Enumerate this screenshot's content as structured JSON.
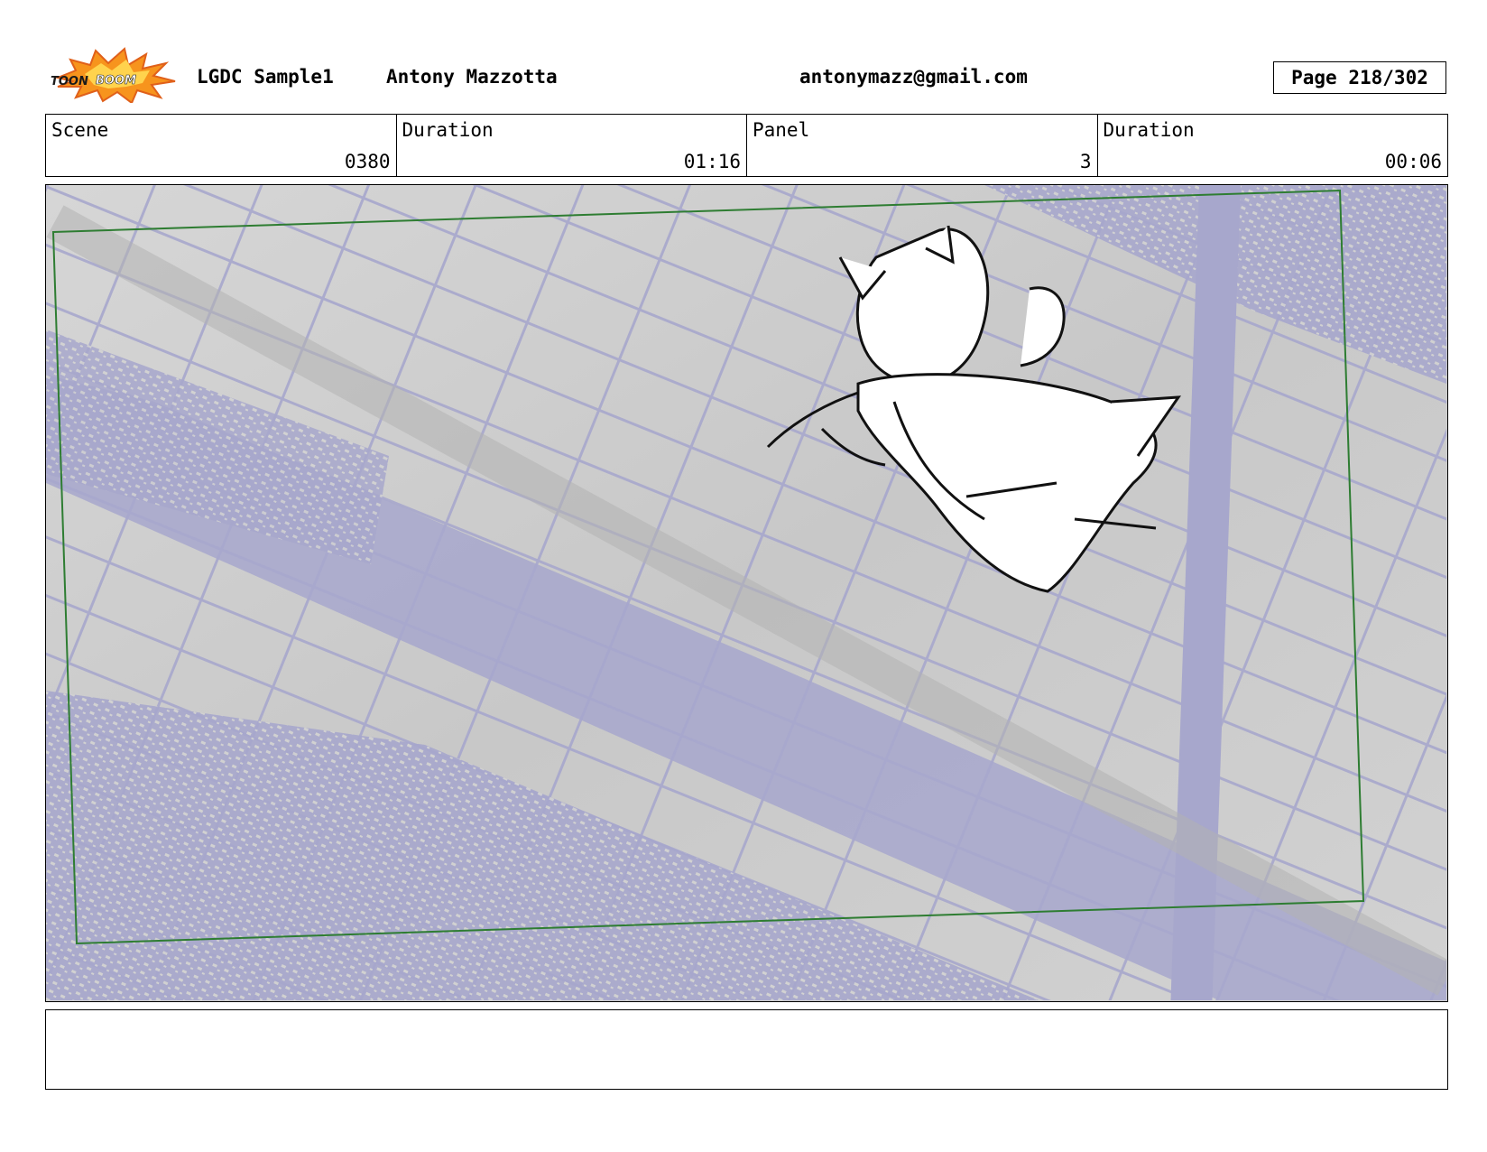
{
  "header": {
    "logo_name": "toonboom-logo",
    "logo_text_top": "TOON",
    "logo_text_bottom": "BOOM",
    "project": "LGDC Sample1",
    "author": "Antony Mazzotta",
    "email": "antonymazz@gmail.com",
    "page_label": "Page",
    "page_value": "218/302"
  },
  "info": {
    "scene_label": "Scene",
    "scene_value": "0380",
    "duration_label": "Duration",
    "duration_value": "01:16",
    "panel_label": "Panel",
    "panel_value": "3",
    "panel_duration_label": "Duration",
    "panel_duration_value": "00:06"
  },
  "colors": {
    "background_gray": "#cfcfcf",
    "building_lavender": "#a7a7cc",
    "camera_frame_green": "#2e7d32",
    "logo_orange": "#f7941d"
  },
  "notes": {
    "text": ""
  }
}
